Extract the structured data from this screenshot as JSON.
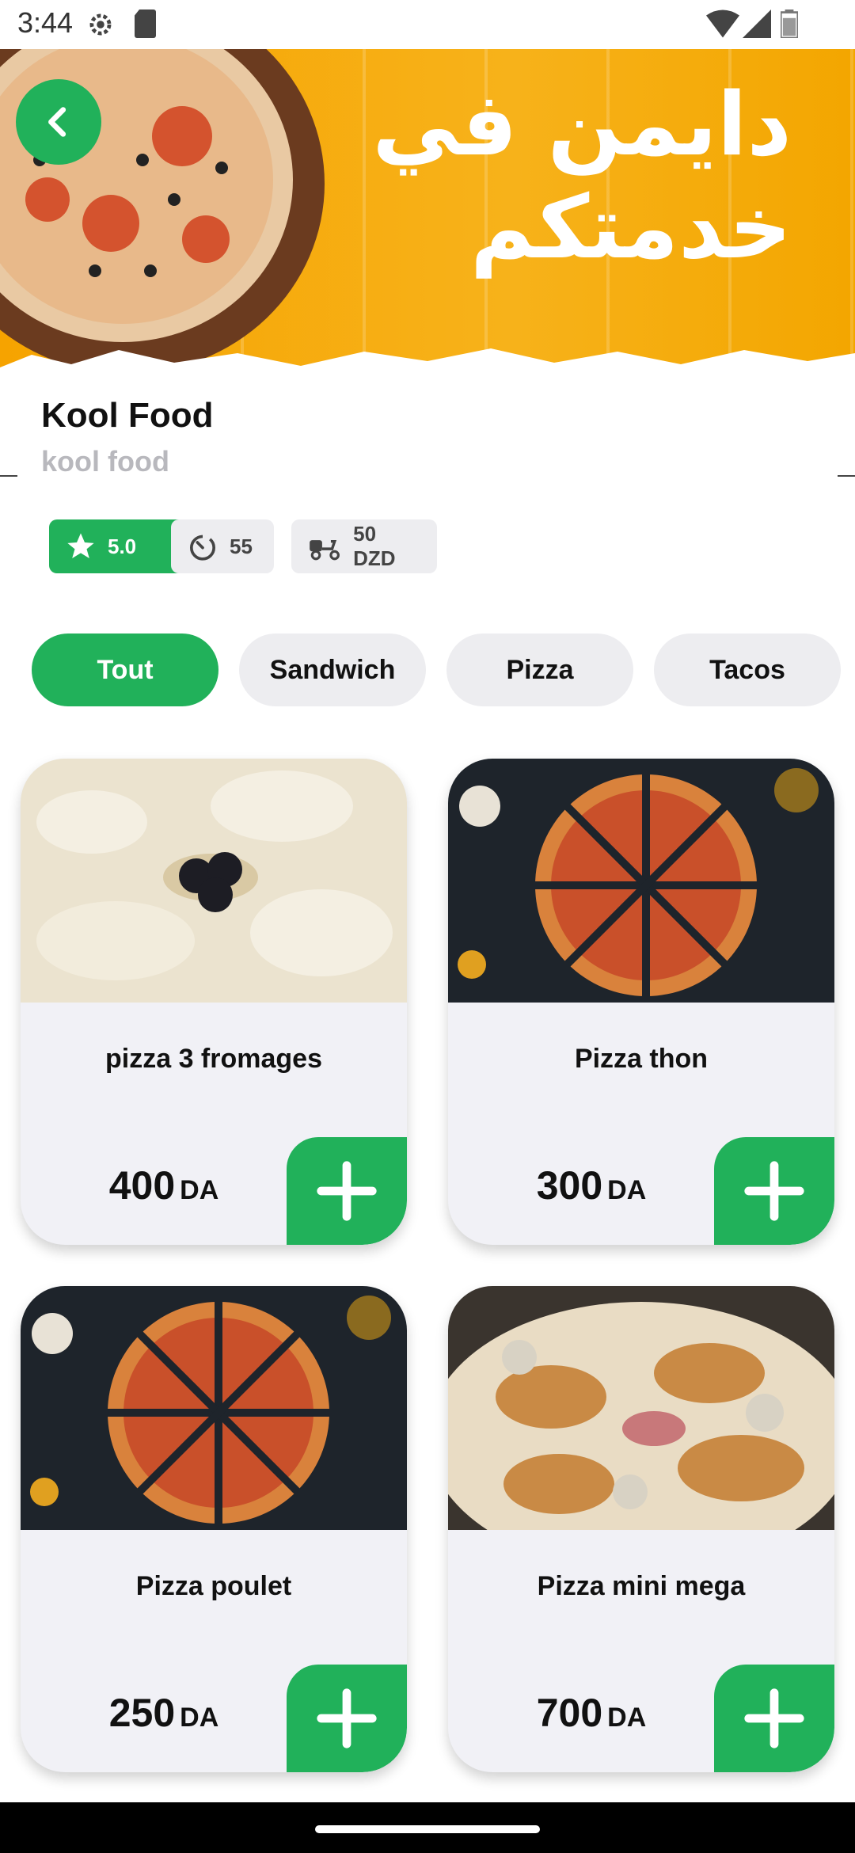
{
  "status_bar": {
    "time": "3:44",
    "icons": [
      "settings-icon",
      "sd-card-icon",
      "wifi-icon",
      "signal-icon",
      "battery-icon"
    ]
  },
  "hero": {
    "banner_text_line1": "دايمن في",
    "banner_text_line2": "خدمتكم",
    "back_icon": "chevron-left-icon"
  },
  "restaurant": {
    "name": "Kool Food",
    "subtitle": "kool food",
    "rating": "5.0",
    "delivery_time": "55",
    "delivery_fee": "50 DZD"
  },
  "categories": [
    {
      "label": "Tout",
      "active": true
    },
    {
      "label": "Sandwich",
      "active": false
    },
    {
      "label": "Pizza",
      "active": false
    },
    {
      "label": "Tacos",
      "active": false
    }
  ],
  "products": [
    {
      "name": "pizza 3 fromages",
      "price": "400",
      "currency": "DA",
      "image": "white-cheese-pizza"
    },
    {
      "name": "Pizza thon",
      "price": "300",
      "currency": "DA",
      "image": "sliced-pizza-dark-table"
    },
    {
      "name": "Pizza poulet",
      "price": "250",
      "currency": "DA",
      "image": "sliced-pizza-dark-table"
    },
    {
      "name": "Pizza mini mega",
      "price": "700",
      "currency": "DA",
      "image": "mushroom-meat-pizza"
    }
  ],
  "colors": {
    "accent": "#21b15a",
    "hero_bg": "#f6a300",
    "chip_bg": "#ededf0",
    "card_bg": "#f1f1f6"
  }
}
